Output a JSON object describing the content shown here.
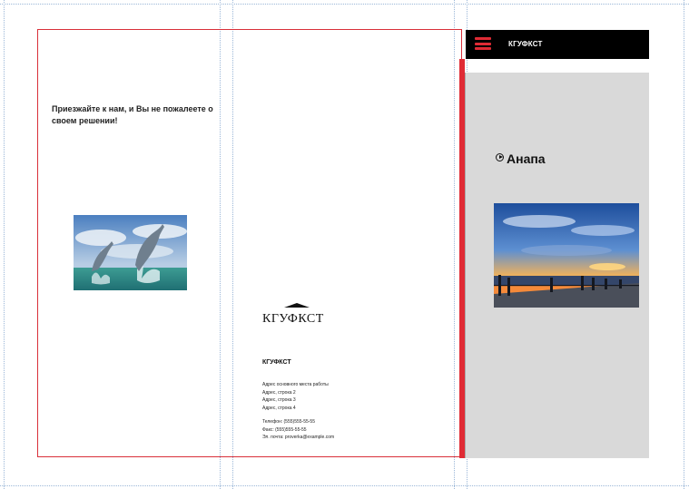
{
  "tagline": "Приезжайте к нам, и Вы не пожалеете о своем решении!",
  "header": {
    "title": "КГУФКСТ"
  },
  "place": {
    "name": "Анапа"
  },
  "logo": {
    "text": "КГУФКСТ"
  },
  "contact": {
    "company": "КГУФКСТ",
    "address_lines": [
      "Адрес основного места работы",
      "Адрес, строка 2",
      "Адрес, строка 3",
      "Адрес, строка 4"
    ],
    "phone": "Телефон: (555)555-55-55",
    "fax": "Факс: (555)555-55-55",
    "email": "Эл. почта: proverka@example.com"
  },
  "colors": {
    "accent": "#e02b35",
    "header_bg": "#000000",
    "panel_bg": "#d9d9d9"
  },
  "icons": [
    "menu-icon",
    "play-circle-icon"
  ]
}
